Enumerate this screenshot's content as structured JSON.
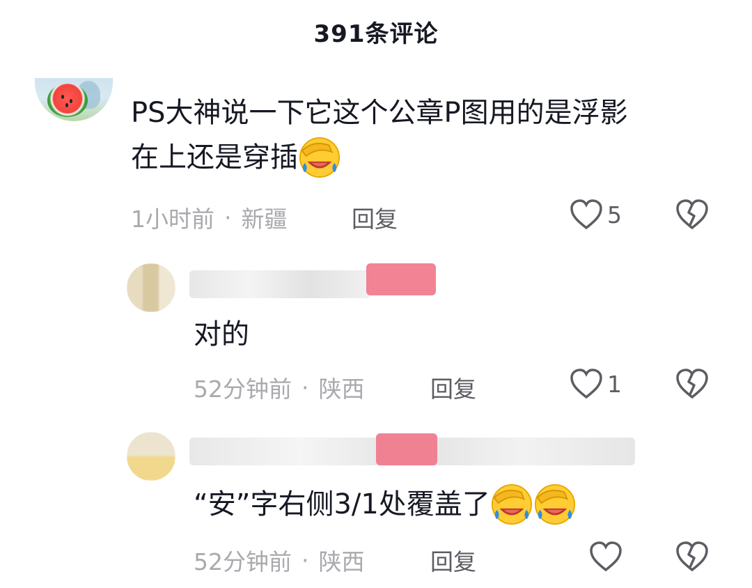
{
  "header": {
    "title": "391条评论"
  },
  "comments": [
    {
      "text_line1": "PS大神说一下它这个公章P图用的是浮影",
      "text_line2": "在上还是穿插",
      "time": "1小时前",
      "location": "新疆",
      "reply_label": "回复",
      "likes": "5"
    },
    {
      "text": "对的",
      "time": "52分钟前",
      "location": "陕西",
      "reply_label": "回复",
      "likes": "1"
    },
    {
      "text": "“安”字右侧3/1处覆盖了",
      "time": "52分钟前",
      "location": "陕西",
      "reply_label": "回复",
      "likes": ""
    }
  ],
  "separator": "·",
  "icons": {
    "like": "heart-outline-icon",
    "dislike": "broken-heart-icon",
    "emoji": "facepalm-laugh-emoji"
  },
  "colors": {
    "text": "#161823",
    "meta": "#a9a9ae",
    "action": "#5c5c63"
  }
}
